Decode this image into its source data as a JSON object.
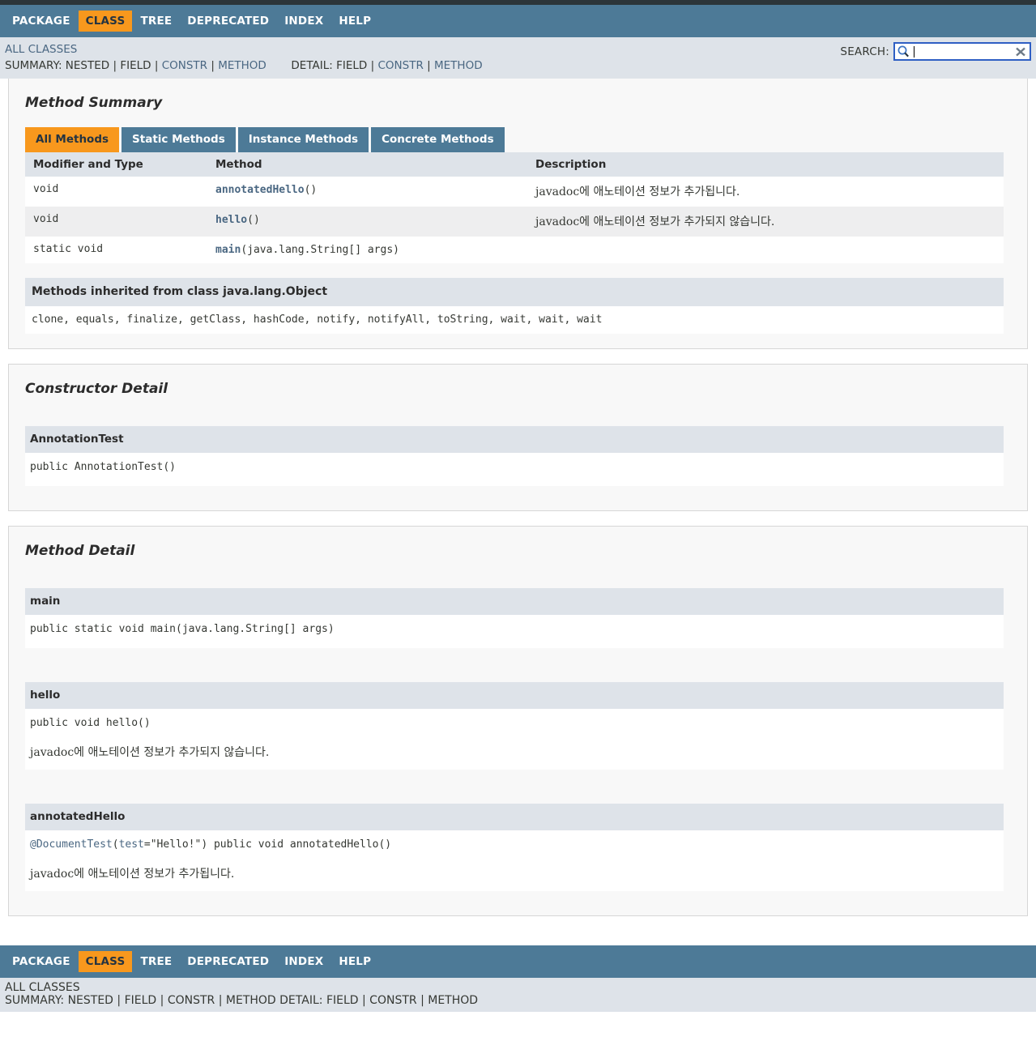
{
  "nav": {
    "items": [
      {
        "label": "PACKAGE",
        "active": false
      },
      {
        "label": "CLASS",
        "active": true
      },
      {
        "label": "TREE",
        "active": false
      },
      {
        "label": "DEPRECATED",
        "active": false
      },
      {
        "label": "INDEX",
        "active": false
      },
      {
        "label": "HELP",
        "active": false
      }
    ]
  },
  "subnav": {
    "all_classes": "ALL CLASSES",
    "summary_prefix": "SUMMARY:",
    "summary_nested": "NESTED",
    "summary_field": "FIELD",
    "summary_constr": "CONSTR",
    "summary_method": "METHOD",
    "detail_prefix": "DETAIL:",
    "detail_field": "FIELD",
    "detail_constr": "CONSTR",
    "detail_method": "METHOD",
    "sep": "|"
  },
  "search": {
    "label": "SEARCH:",
    "value": "",
    "placeholder": "",
    "icon": "search-icon",
    "clear_icon": "close-icon"
  },
  "method_summary": {
    "title": "Method Summary",
    "tabs": [
      {
        "label": "All Methods",
        "active": true
      },
      {
        "label": "Static Methods",
        "active": false
      },
      {
        "label": "Instance Methods",
        "active": false
      },
      {
        "label": "Concrete Methods",
        "active": false
      }
    ],
    "headers": {
      "modifier": "Modifier and Type",
      "method": "Method",
      "description": "Description"
    },
    "rows": [
      {
        "modifier": "void",
        "method_name": "annotatedHello",
        "method_args": "()",
        "description": "javadoc에 애노테이션 정보가 추가됩니다."
      },
      {
        "modifier": "void",
        "method_name": "hello",
        "method_args": "()",
        "description": "javadoc에 애노테이션 정보가 추가되지 않습니다."
      },
      {
        "modifier": "static void",
        "method_name": "main",
        "method_args": "(java.lang.String[] args)",
        "description": ""
      }
    ],
    "inherited": {
      "title": "Methods inherited from class java.lang.Object",
      "methods": "clone, equals, finalize, getClass, hashCode, notify, notifyAll, toString, wait, wait, wait"
    }
  },
  "constructor_detail": {
    "title": "Constructor Detail",
    "items": [
      {
        "name": "AnnotationTest",
        "signature": "public AnnotationTest()",
        "description": ""
      }
    ]
  },
  "method_detail": {
    "title": "Method Detail",
    "items": [
      {
        "name": "main",
        "signature": "public static void main(java.lang.String[] args)",
        "description": ""
      },
      {
        "name": "hello",
        "signature": "public void hello()",
        "description": "javadoc에 애노테이션 정보가 추가되지 않습니다."
      },
      {
        "name": "annotatedHello",
        "annotation": "@DocumentTest",
        "annotation_param": "test",
        "annotation_value": "=\"Hello!\") ",
        "signature": "public void annotatedHello()",
        "description": "javadoc에 애노테이션 정보가 추가됩니다."
      }
    ]
  },
  "colors": {
    "navbar": "#4D7A97",
    "accent": "#F8981D",
    "link": "#4A6782",
    "header_row": "#DEE3E9",
    "alt_row": "#EEEEEF"
  }
}
